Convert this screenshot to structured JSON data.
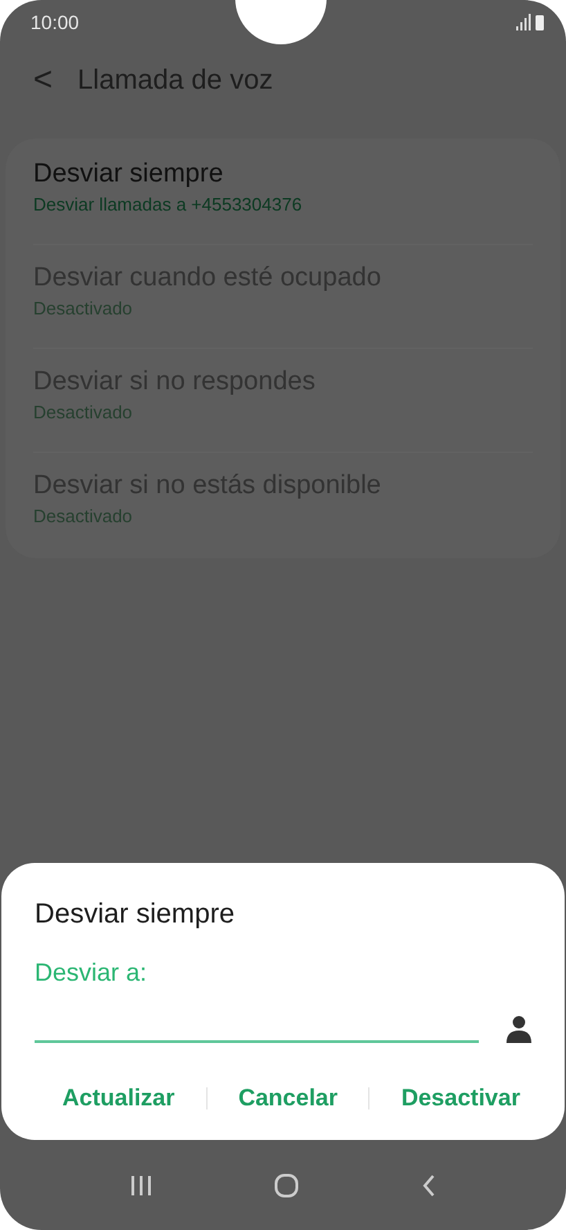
{
  "status_bar": {
    "time": "10:00"
  },
  "header": {
    "back": "<",
    "title": "Llamada de voz"
  },
  "items": [
    {
      "title": "Desviar siempre",
      "subtitle": "Desviar llamadas a +4553304376",
      "disabled": false
    },
    {
      "title": "Desviar cuando esté ocupado",
      "subtitle": "Desactivado",
      "disabled": true
    },
    {
      "title": "Desviar si no respondes",
      "subtitle": "Desactivado",
      "disabled": true
    },
    {
      "title": "Desviar si no estás disponible",
      "subtitle": "Desactivado",
      "disabled": true
    }
  ],
  "dialog": {
    "title": "Desviar siempre",
    "field_label": "Desviar a:",
    "buttons": [
      "Actualizar",
      "Cancelar",
      "Desactivar"
    ]
  }
}
